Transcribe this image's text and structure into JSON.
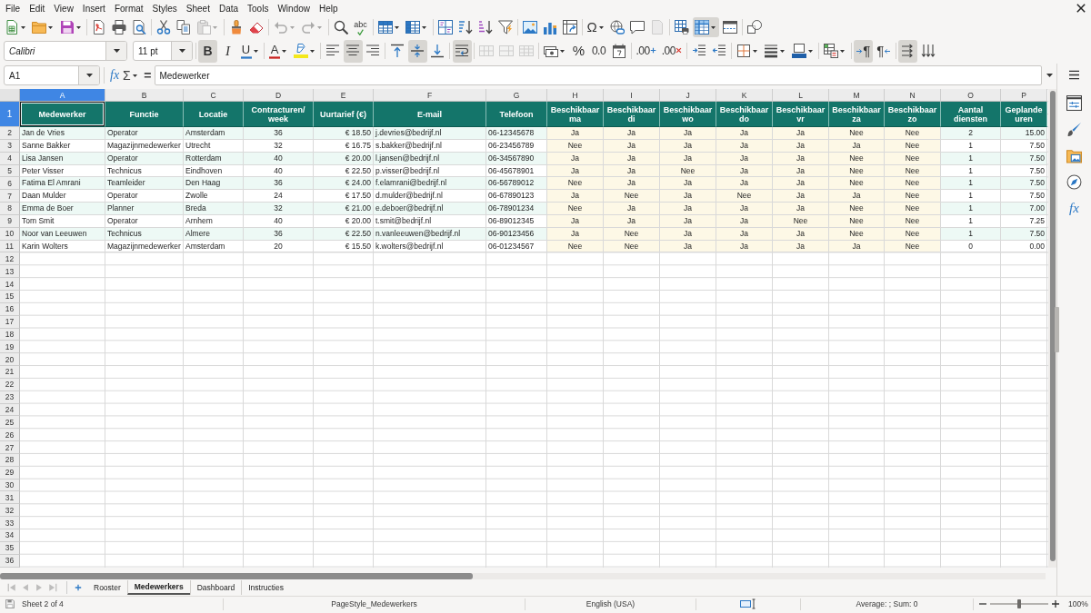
{
  "menu": [
    "File",
    "Edit",
    "View",
    "Insert",
    "Format",
    "Styles",
    "Sheet",
    "Data",
    "Tools",
    "Window",
    "Help"
  ],
  "toolbar_standard": [
    [
      {
        "kind": "new",
        "dropdown": true,
        "on": false,
        "disabled": false
      },
      {
        "kind": "open",
        "dropdown": true,
        "on": false,
        "disabled": false
      },
      {
        "kind": "save",
        "dropdown": true,
        "on": false,
        "disabled": false
      }
    ],
    [
      {
        "kind": "pdf",
        "dropdown": false,
        "on": false,
        "disabled": false
      },
      {
        "kind": "print",
        "dropdown": false,
        "on": false,
        "disabled": false
      },
      {
        "kind": "preview",
        "dropdown": false,
        "on": false,
        "disabled": false
      }
    ],
    [
      {
        "kind": "cut",
        "dropdown": false,
        "on": false,
        "disabled": false
      },
      {
        "kind": "copy",
        "dropdown": false,
        "on": false,
        "disabled": false
      },
      {
        "kind": "paste",
        "dropdown": true,
        "on": false,
        "disabled": true
      }
    ],
    [
      {
        "kind": "clone",
        "dropdown": false,
        "on": false,
        "disabled": false
      },
      {
        "kind": "clear",
        "dropdown": false,
        "on": false,
        "disabled": false
      }
    ],
    [
      {
        "kind": "undo",
        "dropdown": true,
        "on": false,
        "disabled": true
      },
      {
        "kind": "redo",
        "dropdown": true,
        "on": false,
        "disabled": true
      }
    ],
    [
      {
        "kind": "find",
        "dropdown": false,
        "on": false,
        "disabled": false
      },
      {
        "kind": "spell",
        "label": "abc",
        "dropdown": false,
        "on": false,
        "disabled": false
      }
    ],
    [
      {
        "kind": "rows",
        "dropdown": true,
        "on": false,
        "disabled": false
      },
      {
        "kind": "columns",
        "dropdown": true,
        "on": false,
        "disabled": false
      }
    ],
    [
      {
        "kind": "sort",
        "dropdown": false,
        "on": false,
        "disabled": false
      },
      {
        "kind": "sortasc",
        "dropdown": false,
        "on": false,
        "disabled": false
      },
      {
        "kind": "sortdesc",
        "dropdown": false,
        "on": false,
        "disabled": false
      },
      {
        "kind": "filter",
        "dropdown": false,
        "on": false,
        "disabled": false
      }
    ],
    [
      {
        "kind": "image",
        "dropdown": false,
        "on": false,
        "disabled": false
      },
      {
        "kind": "chart",
        "dropdown": false,
        "on": false,
        "disabled": false
      },
      {
        "kind": "pivot",
        "dropdown": false,
        "on": false,
        "disabled": false
      }
    ],
    [
      {
        "kind": "special",
        "label": "Ω",
        "dropdown": true,
        "on": false,
        "disabled": false
      },
      {
        "kind": "link",
        "dropdown": false,
        "on": false,
        "disabled": false
      },
      {
        "kind": "comment",
        "dropdown": false,
        "on": false,
        "disabled": false
      },
      {
        "kind": "headerfooter",
        "dropdown": false,
        "on": false,
        "disabled": true
      }
    ],
    [
      {
        "kind": "printarea",
        "dropdown": false,
        "on": false,
        "disabled": false
      },
      {
        "kind": "freeze",
        "dropdown": true,
        "on": true,
        "disabled": false
      },
      {
        "kind": "split",
        "dropdown": false,
        "on": false,
        "disabled": false
      }
    ],
    [
      {
        "kind": "shapes",
        "dropdown": false,
        "on": false,
        "disabled": false
      }
    ]
  ],
  "formatting": {
    "font_name": "Calibri",
    "font_size": "11 pt",
    "groups": [
      [
        {
          "kind": "bold",
          "label": "B",
          "dropdown": false,
          "on": true,
          "disabled": false
        },
        {
          "kind": "italic",
          "label": "I",
          "dropdown": false,
          "on": false,
          "disabled": false
        },
        {
          "kind": "underline",
          "label": "U",
          "dropdown": true,
          "on": false,
          "disabled": false
        }
      ],
      [
        {
          "kind": "fontcolor",
          "label": "A",
          "dropdown": true,
          "on": false,
          "disabled": false
        },
        {
          "kind": "highlight",
          "dropdown": true,
          "on": false,
          "disabled": false
        }
      ],
      [
        {
          "kind": "alignleft",
          "dropdown": false,
          "on": false,
          "disabled": false
        },
        {
          "kind": "aligncenter",
          "dropdown": false,
          "on": true,
          "disabled": false
        },
        {
          "kind": "alignright",
          "dropdown": false,
          "on": false,
          "disabled": false
        }
      ],
      [
        {
          "kind": "aligntop",
          "dropdown": false,
          "on": false,
          "disabled": false
        },
        {
          "kind": "alignmiddle",
          "dropdown": false,
          "on": true,
          "disabled": false
        },
        {
          "kind": "alignbottom",
          "dropdown": false,
          "on": false,
          "disabled": false
        }
      ],
      [
        {
          "kind": "wrap",
          "dropdown": false,
          "on": true,
          "disabled": false
        }
      ],
      [
        {
          "kind": "mergecenter",
          "dropdown": false,
          "on": false,
          "disabled": true
        },
        {
          "kind": "merge",
          "dropdown": false,
          "on": false,
          "disabled": true
        },
        {
          "kind": "unmerge",
          "dropdown": false,
          "on": false,
          "disabled": true
        }
      ],
      [
        {
          "kind": "currency",
          "dropdown": true,
          "on": false,
          "disabled": false
        },
        {
          "kind": "percent",
          "label": "%",
          "dropdown": false,
          "on": false,
          "disabled": false
        },
        {
          "kind": "number",
          "label": "0.0",
          "dropdown": false,
          "on": false,
          "disabled": false
        },
        {
          "kind": "date",
          "dropdown": false,
          "on": false,
          "disabled": false
        }
      ],
      [
        {
          "kind": "adddecimal",
          "label": ".00",
          "dropdown": false,
          "on": false,
          "disabled": false
        },
        {
          "kind": "deletedecimal",
          "label": ".00",
          "dropdown": false,
          "on": false,
          "disabled": false
        }
      ],
      [
        {
          "kind": "indent",
          "dropdown": false,
          "on": false,
          "disabled": false
        },
        {
          "kind": "outdent",
          "dropdown": false,
          "on": false,
          "disabled": false
        }
      ],
      [
        {
          "kind": "borders",
          "dropdown": true,
          "on": false,
          "disabled": false
        },
        {
          "kind": "borderstyle",
          "dropdown": true,
          "on": false,
          "disabled": false
        },
        {
          "kind": "bordercolor",
          "dropdown": true,
          "on": false,
          "disabled": false
        }
      ],
      [
        {
          "kind": "conditional",
          "dropdown": true,
          "on": false,
          "disabled": false
        }
      ],
      [
        {
          "kind": "ltr",
          "label": "¶",
          "dropdown": false,
          "on": true,
          "disabled": false
        },
        {
          "kind": "rtl",
          "label": "¶",
          "dropdown": false,
          "on": false,
          "disabled": false
        }
      ],
      [
        {
          "kind": "textdir",
          "dropdown": false,
          "on": true,
          "disabled": false
        },
        {
          "kind": "vertical",
          "dropdown": false,
          "on": false,
          "disabled": false
        }
      ]
    ]
  },
  "formula_bar": {
    "name_box": "A1",
    "wizard": "fx",
    "sum": "Σ",
    "equals": "=",
    "content": "Medewerker"
  },
  "sidebar": [
    {
      "kind": "properties"
    },
    {
      "kind": "styles"
    },
    {
      "kind": "gallery"
    },
    {
      "kind": "navigator"
    },
    {
      "kind": "functions",
      "label": "fx"
    }
  ],
  "sheet": {
    "columns": [
      {
        "letter": "A",
        "selected": true
      },
      {
        "letter": "B",
        "selected": false
      },
      {
        "letter": "C",
        "selected": false
      },
      {
        "letter": "D",
        "selected": false
      },
      {
        "letter": "E",
        "selected": false
      },
      {
        "letter": "F",
        "selected": false
      },
      {
        "letter": "G",
        "selected": false
      },
      {
        "letter": "H",
        "selected": false
      },
      {
        "letter": "I",
        "selected": false
      },
      {
        "letter": "J",
        "selected": false
      },
      {
        "letter": "K",
        "selected": false
      },
      {
        "letter": "L",
        "selected": false
      },
      {
        "letter": "M",
        "selected": false
      },
      {
        "letter": "N",
        "selected": false
      },
      {
        "letter": "O",
        "selected": false
      },
      {
        "letter": "P",
        "selected": false
      }
    ],
    "rows": [
      {
        "number": "1",
        "selected": true,
        "kind": "header",
        "cells": [
          "Medewerker",
          "Functie",
          "Locatie",
          "Contracturen/ week",
          "Uurtarief (€)",
          "E-mail",
          "Telefoon",
          "Beschikbaar ma",
          "Beschikbaar di",
          "Beschikbaar wo",
          "Beschikbaar do",
          "Beschikbaar vr",
          "Beschikbaar za",
          "Beschikbaar zo",
          "Aantal diensten",
          "Geplande uren"
        ]
      },
      {
        "number": "2",
        "selected": false,
        "kind": "data",
        "cells": [
          "Jan de Vries",
          "Operator",
          "Amsterdam",
          "36",
          "€ 18.50",
          "j.devries@bedrijf.nl",
          "06-12345678",
          "Ja",
          "Ja",
          "Ja",
          "Ja",
          "Ja",
          "Nee",
          "Nee",
          "2",
          "15.00"
        ]
      },
      {
        "number": "3",
        "selected": false,
        "kind": "data",
        "cells": [
          "Sanne Bakker",
          "Magazijnmedewerker",
          "Utrecht",
          "32",
          "€ 16.75",
          "s.bakker@bedrijf.nl",
          "06-23456789",
          "Nee",
          "Ja",
          "Ja",
          "Ja",
          "Ja",
          "Ja",
          "Nee",
          "1",
          "7.50"
        ]
      },
      {
        "number": "4",
        "selected": false,
        "kind": "data",
        "cells": [
          "Lisa Jansen",
          "Operator",
          "Rotterdam",
          "40",
          "€ 20.00",
          "l.jansen@bedrijf.nl",
          "06-34567890",
          "Ja",
          "Ja",
          "Ja",
          "Ja",
          "Ja",
          "Nee",
          "Nee",
          "1",
          "7.50"
        ]
      },
      {
        "number": "5",
        "selected": false,
        "kind": "data",
        "cells": [
          "Peter Visser",
          "Technicus",
          "Eindhoven",
          "40",
          "€ 22.50",
          "p.visser@bedrijf.nl",
          "06-45678901",
          "Ja",
          "Ja",
          "Nee",
          "Ja",
          "Ja",
          "Nee",
          "Nee",
          "1",
          "7.50"
        ]
      },
      {
        "number": "6",
        "selected": false,
        "kind": "data",
        "cells": [
          "Fatima El Amrani",
          "Teamleider",
          "Den Haag",
          "36",
          "€ 24.00",
          "f.elamrani@bedrijf.nl",
          "06-56789012",
          "Nee",
          "Ja",
          "Ja",
          "Ja",
          "Ja",
          "Nee",
          "Nee",
          "1",
          "7.50"
        ]
      },
      {
        "number": "7",
        "selected": false,
        "kind": "data",
        "cells": [
          "Daan Mulder",
          "Operator",
          "Zwolle",
          "24",
          "€ 17.50",
          "d.mulder@bedrijf.nl",
          "06-67890123",
          "Ja",
          "Nee",
          "Ja",
          "Nee",
          "Ja",
          "Ja",
          "Nee",
          "1",
          "7.50"
        ]
      },
      {
        "number": "8",
        "selected": false,
        "kind": "data",
        "cells": [
          "Emma de Boer",
          "Planner",
          "Breda",
          "32",
          "€ 21.00",
          "e.deboer@bedrijf.nl",
          "06-78901234",
          "Nee",
          "Ja",
          "Ja",
          "Ja",
          "Ja",
          "Nee",
          "Nee",
          "1",
          "7.00"
        ]
      },
      {
        "number": "9",
        "selected": false,
        "kind": "data",
        "cells": [
          "Tom Smit",
          "Operator",
          "Arnhem",
          "40",
          "€ 20.00",
          "t.smit@bedrijf.nl",
          "06-89012345",
          "Ja",
          "Ja",
          "Ja",
          "Ja",
          "Nee",
          "Nee",
          "Nee",
          "1",
          "7.25"
        ]
      },
      {
        "number": "10",
        "selected": false,
        "kind": "data",
        "cells": [
          "Noor van Leeuwen",
          "Technicus",
          "Almere",
          "36",
          "€ 22.50",
          "n.vanleeuwen@bedrijf.nl",
          "06-90123456",
          "Ja",
          "Nee",
          "Ja",
          "Ja",
          "Ja",
          "Nee",
          "Nee",
          "1",
          "7.50"
        ]
      },
      {
        "number": "11",
        "selected": false,
        "kind": "data",
        "cells": [
          "Karin Wolters",
          "Magazijnmedewerker",
          "Amsterdam",
          "20",
          "€ 15.50",
          "k.wolters@bedrijf.nl",
          "06-01234567",
          "Nee",
          "Nee",
          "Ja",
          "Ja",
          "Ja",
          "Ja",
          "Nee",
          "0",
          "0.00"
        ]
      },
      {
        "number": "12",
        "selected": false,
        "kind": "data"
      },
      {
        "number": "13",
        "selected": false,
        "kind": "data"
      },
      {
        "number": "14",
        "selected": false,
        "kind": "data"
      },
      {
        "number": "15",
        "selected": false,
        "kind": "data"
      },
      {
        "number": "16",
        "selected": false,
        "kind": "data"
      },
      {
        "number": "17",
        "selected": false,
        "kind": "data"
      },
      {
        "number": "18",
        "selected": false,
        "kind": "data"
      },
      {
        "number": "19",
        "selected": false,
        "kind": "data"
      },
      {
        "number": "20",
        "selected": false,
        "kind": "data"
      },
      {
        "number": "21",
        "selected": false,
        "kind": "data"
      },
      {
        "number": "22",
        "selected": false,
        "kind": "data"
      },
      {
        "number": "23",
        "selected": false,
        "kind": "data"
      },
      {
        "number": "24",
        "selected": false,
        "kind": "data"
      },
      {
        "number": "25",
        "selected": false,
        "kind": "data"
      },
      {
        "number": "26",
        "selected": false,
        "kind": "data"
      },
      {
        "number": "27",
        "selected": false,
        "kind": "data"
      },
      {
        "number": "28",
        "selected": false,
        "kind": "data"
      },
      {
        "number": "29",
        "selected": false,
        "kind": "data"
      },
      {
        "number": "30",
        "selected": false,
        "kind": "data"
      },
      {
        "number": "31",
        "selected": false,
        "kind": "data"
      },
      {
        "number": "32",
        "selected": false,
        "kind": "data"
      },
      {
        "number": "33",
        "selected": false,
        "kind": "data"
      },
      {
        "number": "34",
        "selected": false,
        "kind": "data"
      },
      {
        "number": "35",
        "selected": false,
        "kind": "data"
      },
      {
        "number": "36",
        "selected": false,
        "kind": "data"
      }
    ]
  },
  "sheet_tabs": {
    "navigation": [
      {
        "kind": "first",
        "disabled": true
      },
      {
        "kind": "previous",
        "disabled": true
      },
      {
        "kind": "next",
        "disabled": true
      },
      {
        "kind": "last",
        "disabled": true
      }
    ],
    "tabs": [
      {
        "label": "Rooster",
        "selected": false
      },
      {
        "label": "Medewerkers",
        "selected": true
      },
      {
        "label": "Dashboard",
        "selected": false
      },
      {
        "label": "Instructies",
        "selected": false
      }
    ]
  },
  "status_bar": {
    "sheet": "Sheet 2 of 4",
    "page_style": "PageStyle_Medewerkers",
    "language": "English (USA)",
    "selection_summary": "Average: ; Sum: 0",
    "zoom": {
      "level": 0.5,
      "reading": "100%"
    }
  }
}
